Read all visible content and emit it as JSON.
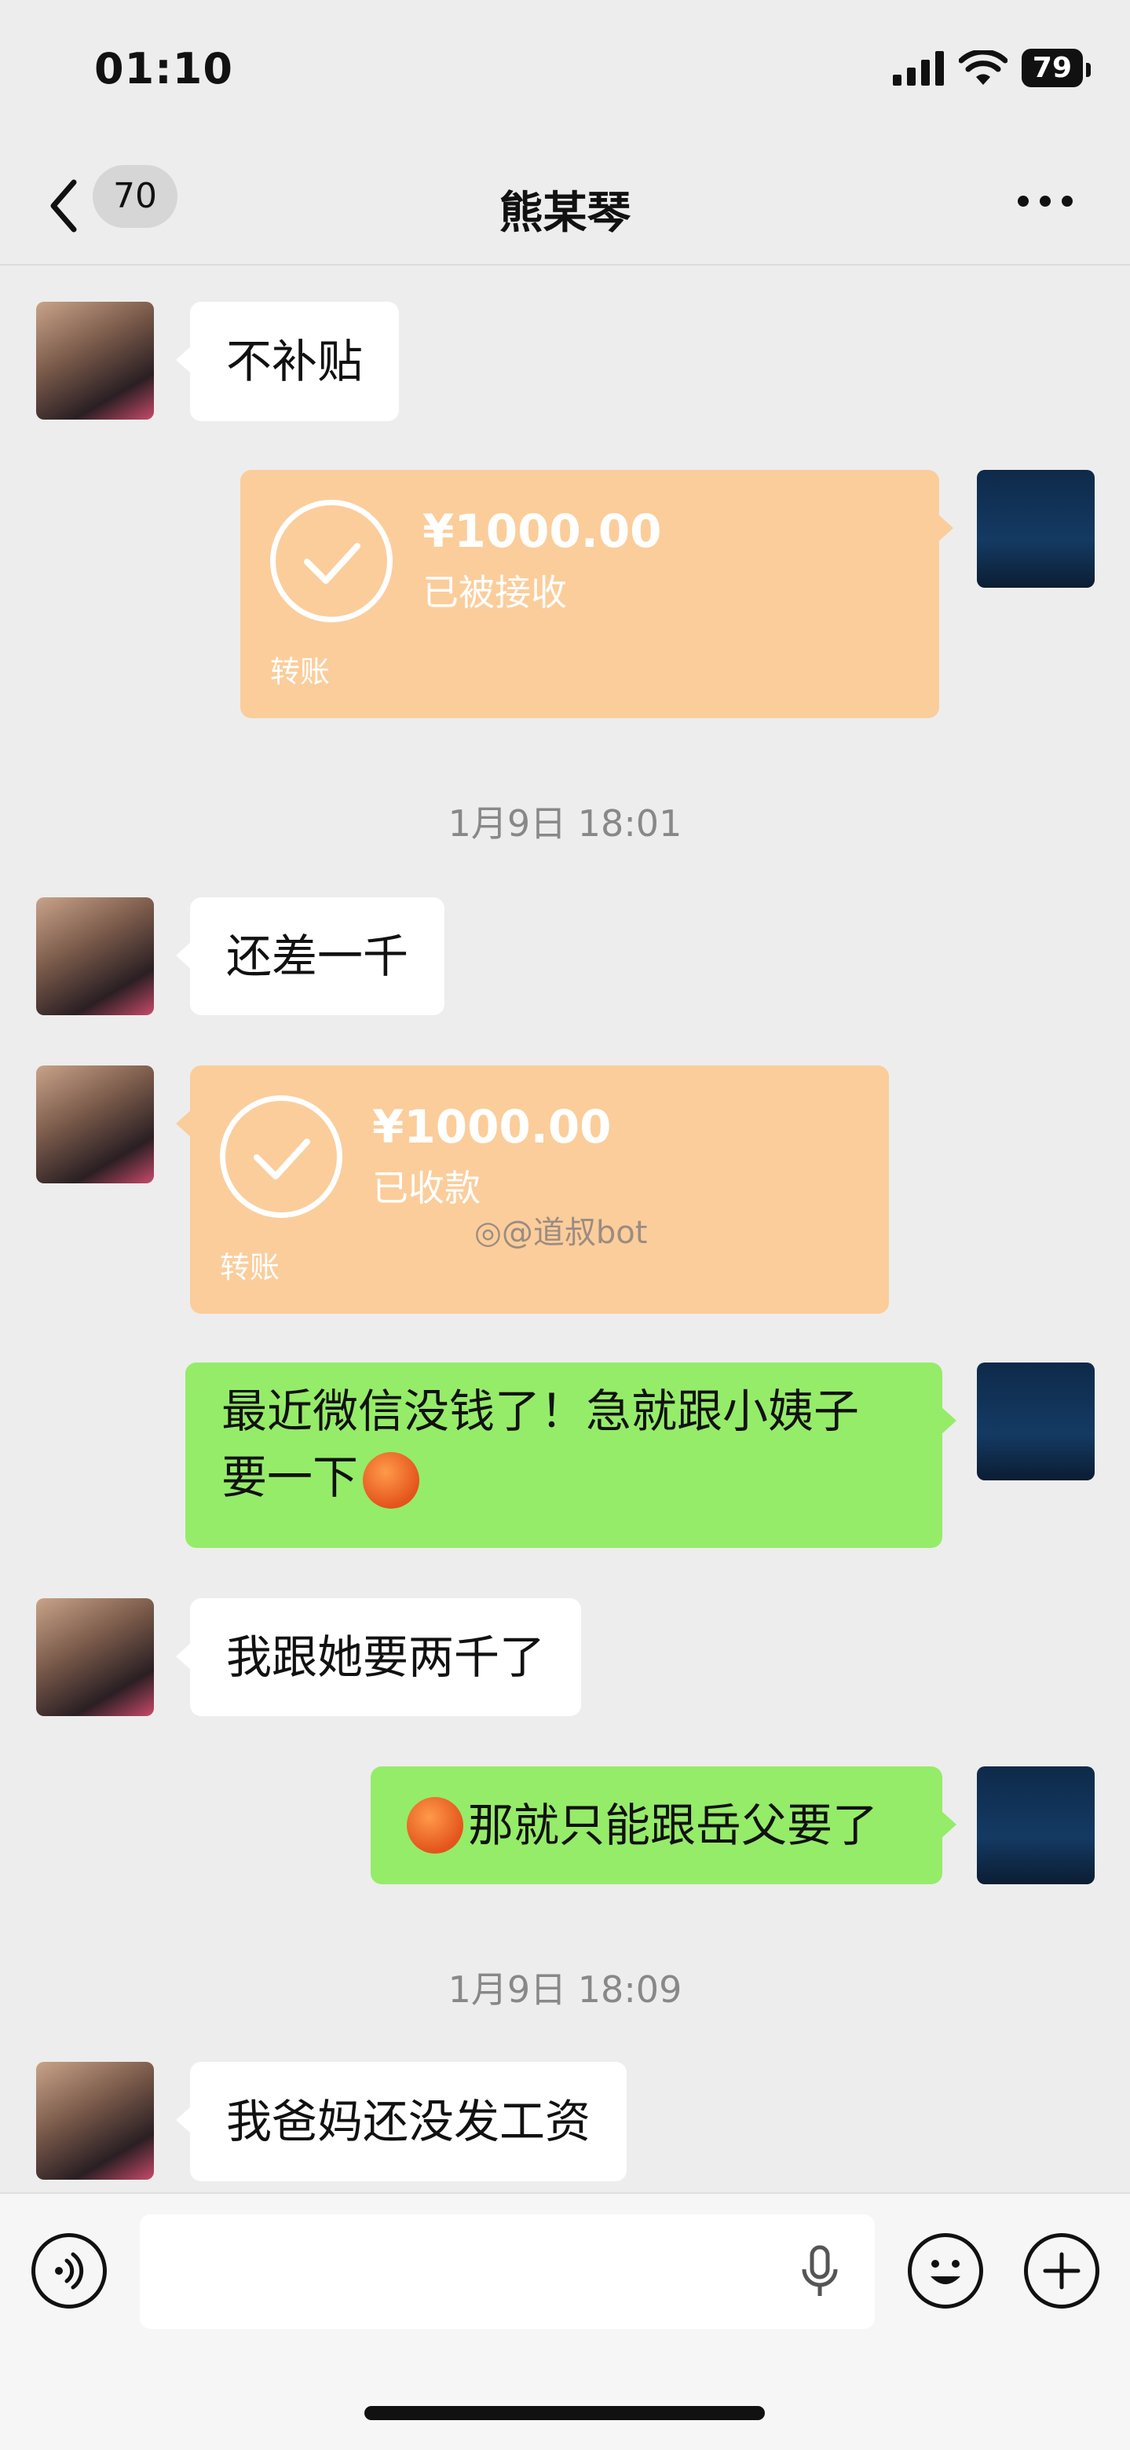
{
  "status_bar": {
    "time": "01:10",
    "battery": "79"
  },
  "nav": {
    "unread_count": "70",
    "title": "熊某琴"
  },
  "messages": [
    {
      "side": "left",
      "type": "text",
      "text": "不补贴"
    },
    {
      "side": "right",
      "type": "transfer",
      "amount": "¥1000.00",
      "status": "已被接收",
      "label": "转账"
    },
    {
      "type": "timestamp",
      "text": "1月9日 18:01"
    },
    {
      "side": "left",
      "type": "text",
      "text": "还差一千"
    },
    {
      "side": "left",
      "type": "transfer",
      "amount": "¥1000.00",
      "status": "已收款",
      "label": "转账"
    },
    {
      "side": "right",
      "type": "text",
      "text_line1": "最近微信没钱了！急就跟小姨子",
      "text_line2": "要一下"
    },
    {
      "side": "left",
      "type": "text",
      "text": "我跟她要两千了"
    },
    {
      "side": "right",
      "type": "text",
      "text": "那就只能跟岳父要了"
    },
    {
      "type": "timestamp",
      "text": "1月9日 18:09"
    },
    {
      "side": "left",
      "type": "text",
      "text": "我爸妈还没发工资"
    }
  ],
  "watermark": "@道叔bot",
  "colors": {
    "background": "#ededed",
    "bubble_green": "#95ec69",
    "bubble_white": "#ffffff",
    "transfer": "#fbcd9b"
  }
}
